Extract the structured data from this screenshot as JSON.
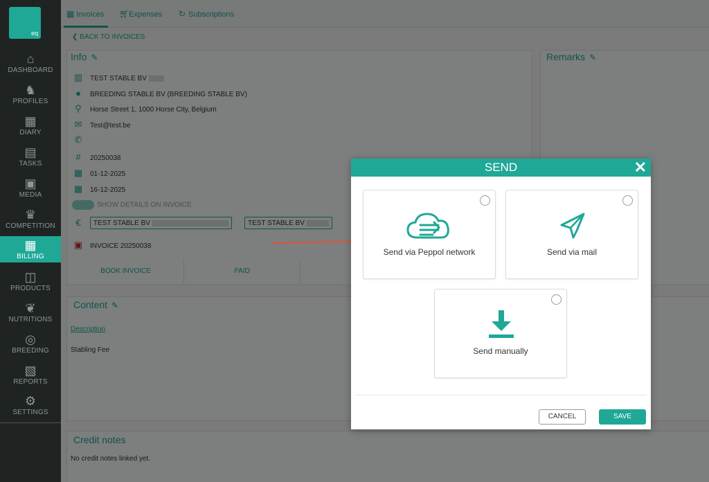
{
  "sidebar": {
    "logo_text": "eq",
    "items": [
      {
        "label": "DASHBOARD",
        "icon": "barn-icon"
      },
      {
        "label": "PROFILES",
        "icon": "horse-icon"
      },
      {
        "label": "DIARY",
        "icon": "calendar-icon"
      },
      {
        "label": "TASKS",
        "icon": "clipboard-icon"
      },
      {
        "label": "MEDIA",
        "icon": "camera-icon"
      },
      {
        "label": "COMPETITION",
        "icon": "trophy-icon"
      },
      {
        "label": "BILLING",
        "icon": "calculator-icon"
      },
      {
        "label": "PRODUCTS",
        "icon": "box-icon"
      },
      {
        "label": "NUTRITIONS",
        "icon": "wheat-icon"
      },
      {
        "label": "BREEDING",
        "icon": "compass-icon"
      },
      {
        "label": "REPORTS",
        "icon": "report-icon"
      },
      {
        "label": "SETTINGS",
        "icon": "gear-icon"
      }
    ],
    "active": "BILLING"
  },
  "tabs": {
    "invoices": "Invoices",
    "expenses": "Expenses",
    "subscriptions": "Subscriptions"
  },
  "back_label": "BACK TO INVOICES",
  "info": {
    "title": "Info",
    "company": "TEST STABLE BV",
    "customer": "BREEDING STABLE BV (BREEDING STABLE BV)",
    "address": "Horse Street 1, 1000 Horse City, Belgium",
    "email": "Test@test.be",
    "invoice_number": "20250038",
    "date": "01-12-2025",
    "due_date": "16-12-2025",
    "toggle_label": "SHOW DETAILS ON INVOICE",
    "chip1": "TEST STABLE BV",
    "chip2": "TEST STABLE BV",
    "pdf_label": "INVOICE 20250038",
    "book_label": "BOOK INVOICE",
    "paid_label": "PAID"
  },
  "remarks": {
    "title": "Remarks"
  },
  "content": {
    "title": "Content",
    "col_description": "Description",
    "row1": "Stabling Fee"
  },
  "credit": {
    "title": "Credit notes",
    "empty": "No credit notes linked yet."
  },
  "modal": {
    "title": "SEND",
    "options": [
      {
        "label": "Send via Peppol network",
        "icon": "cloud-icon"
      },
      {
        "label": "Send via mail",
        "icon": "paper-plane-icon"
      },
      {
        "label": "Send manually",
        "icon": "download-icon"
      }
    ],
    "cancel": "CANCEL",
    "save": "SAVE"
  },
  "colors": {
    "accent": "#1fa896",
    "sidebar": "#1f2423",
    "arrow": "#e0533a"
  }
}
